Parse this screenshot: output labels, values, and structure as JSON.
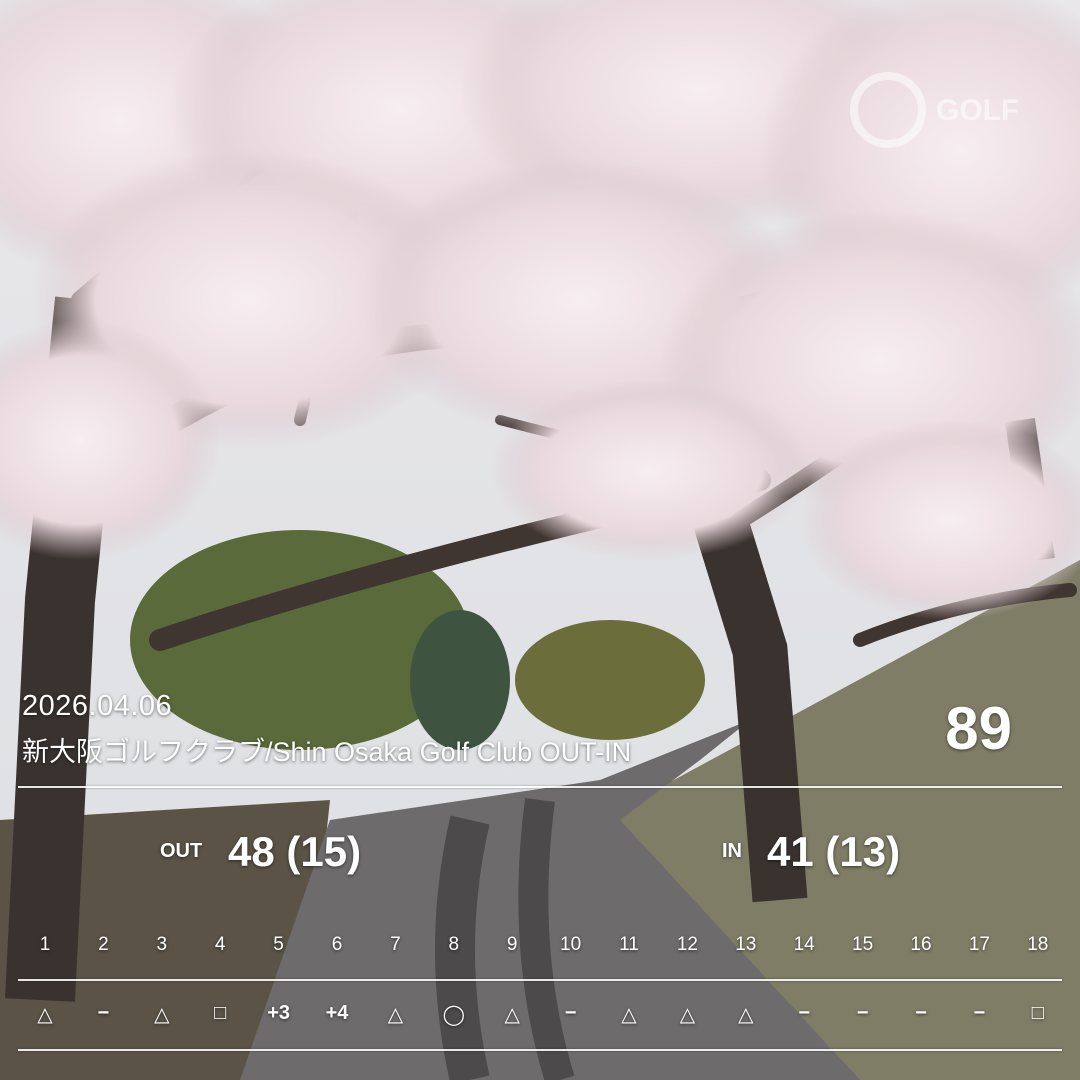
{
  "round": {
    "date": "2026.04.06",
    "course": "新大阪ゴルフクラブ/Shin Osaka Golf Club OUT-IN",
    "total": "89"
  },
  "out": {
    "label": "OUT",
    "score": "48 (15)"
  },
  "in": {
    "label": "IN",
    "score": "41 (13)"
  },
  "holes": [
    "1",
    "2",
    "3",
    "4",
    "5",
    "6",
    "7",
    "8",
    "9",
    "10",
    "11",
    "12",
    "13",
    "14",
    "15",
    "16",
    "17",
    "18"
  ],
  "results": [
    "△",
    "−",
    "△",
    "□",
    "+3",
    "+4",
    "△",
    "◯",
    "△",
    "−",
    "△",
    "△",
    "△",
    "−",
    "−",
    "−",
    "−",
    "□"
  ],
  "logo": {
    "text": "GOLF",
    "icon": "golf-app-logo-icon"
  },
  "colors": {
    "overlay_text": "#ffffff",
    "blossom": "#f1e6ea",
    "branch": "#3f3531",
    "road": "#6b6a6a",
    "grass": "#8b8a6e"
  }
}
